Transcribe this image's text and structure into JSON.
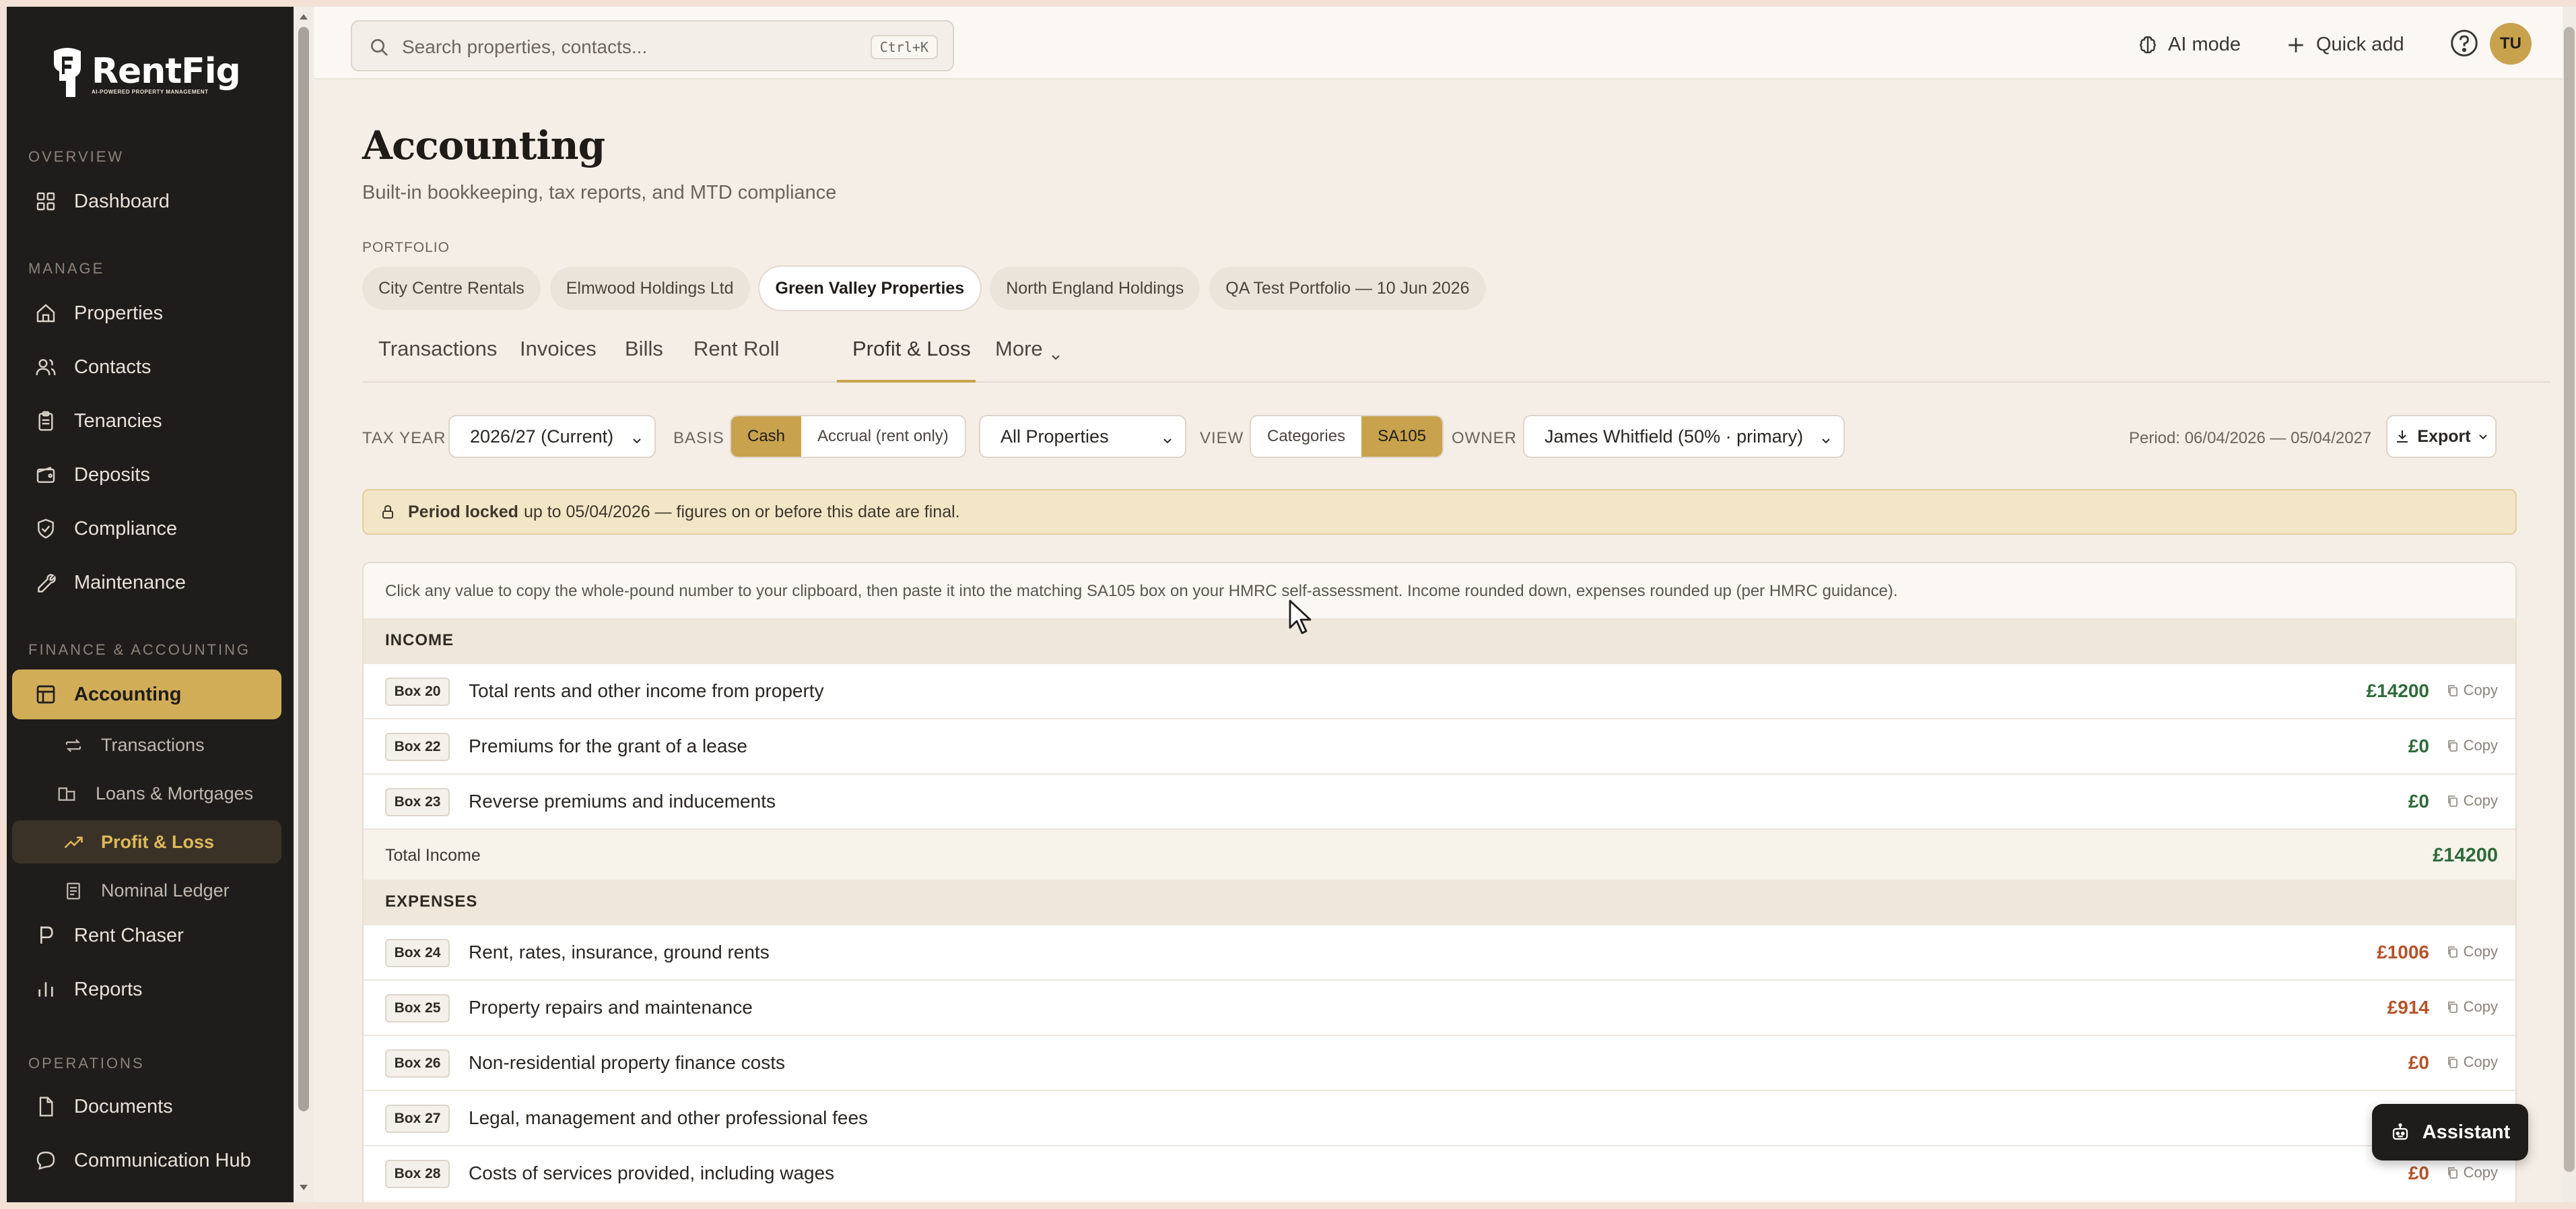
{
  "app": {
    "brand": "RentFig",
    "tagline": "AI-POWERED PROPERTY MANAGEMENT"
  },
  "sidebar": {
    "sections": {
      "overview": "OVERVIEW",
      "manage": "MANAGE",
      "finance": "FINANCE & ACCOUNTING",
      "operations": "OPERATIONS"
    },
    "items": {
      "dashboard": "Dashboard",
      "properties": "Properties",
      "contacts": "Contacts",
      "tenancies": "Tenancies",
      "deposits": "Deposits",
      "compliance": "Compliance",
      "maintenance": "Maintenance",
      "accounting": "Accounting",
      "rent_chaser": "Rent Chaser",
      "reports": "Reports",
      "documents": "Documents",
      "communication_hub": "Communication Hub"
    },
    "sub_items": {
      "transactions": "Transactions",
      "loans": "Loans & Mortgages",
      "profit_loss": "Profit & Loss",
      "nominal_ledger": "Nominal Ledger"
    }
  },
  "topbar": {
    "search_placeholder": "Search properties, contacts...",
    "search_shortcut": "Ctrl+K",
    "ai_mode": "AI mode",
    "quick_add": "Quick add",
    "avatar_initials": "TU"
  },
  "page": {
    "title": "Accounting",
    "subtitle": "Built-in bookkeeping, tax reports, and MTD compliance",
    "portfolio_label": "PORTFOLIO",
    "portfolios": [
      "City Centre Rentals",
      "Elmwood Holdings Ltd",
      "Green Valley Properties",
      "North England Holdings",
      "QA Test Portfolio — 10 Jun 2026"
    ],
    "active_portfolio": "Green Valley Properties",
    "tabs": [
      "Transactions",
      "Invoices",
      "Bills",
      "Rent Roll",
      "Profit & Loss",
      "More"
    ],
    "active_tab": "Profit & Loss"
  },
  "filters": {
    "tax_year_label": "TAX YEAR",
    "tax_year_value": "2026/27 (Current)",
    "basis_label": "BASIS",
    "basis_options": [
      "Cash",
      "Accrual (rent only)"
    ],
    "basis_selected": "Cash",
    "properties_value": "All Properties",
    "view_label": "VIEW",
    "view_options": [
      "Categories",
      "SA105"
    ],
    "view_selected": "SA105",
    "owner_label": "OWNER",
    "owner_value": "James Whitfield (50% · primary)",
    "period": "Period: 06/04/2026 — 05/04/2027",
    "export_label": "Export"
  },
  "lock_banner": {
    "bold": "Period locked",
    "text": "up to 05/04/2026 — figures on or before this date are final."
  },
  "sa105": {
    "note": "Click any value to copy the whole-pound number to your clipboard, then paste it into the matching SA105 box on your HMRC self-assessment. Income rounded down, expenses rounded up (per HMRC guidance).",
    "copy_label": "Copy",
    "income_heading": "INCOME",
    "income_rows": [
      {
        "box": "Box 20",
        "label": "Total rents and other income from property",
        "value": "£14200"
      },
      {
        "box": "Box 22",
        "label": "Premiums for the grant of a lease",
        "value": "£0"
      },
      {
        "box": "Box 23",
        "label": "Reverse premiums and inducements",
        "value": "£0"
      }
    ],
    "total_income_label": "Total Income",
    "total_income_value": "£14200",
    "expenses_heading": "EXPENSES",
    "expense_rows": [
      {
        "box": "Box 24",
        "label": "Rent, rates, insurance, ground rents",
        "value": "£1006"
      },
      {
        "box": "Box 25",
        "label": "Property repairs and maintenance",
        "value": "£914"
      },
      {
        "box": "Box 26",
        "label": "Non-residential property finance costs",
        "value": "£0"
      },
      {
        "box": "Box 27",
        "label": "Legal, management and other professional fees",
        "value": ""
      },
      {
        "box": "Box 28",
        "label": "Costs of services provided, including wages",
        "value": "£0"
      }
    ]
  },
  "assistant": {
    "label": "Assistant"
  },
  "colors": {
    "accent": "#c9a24d",
    "sidebar_bg": "#1f1d1b",
    "income_green": "#2f6b3a",
    "expense_orange": "#b5532b",
    "page_bg": "#f4eee6"
  }
}
